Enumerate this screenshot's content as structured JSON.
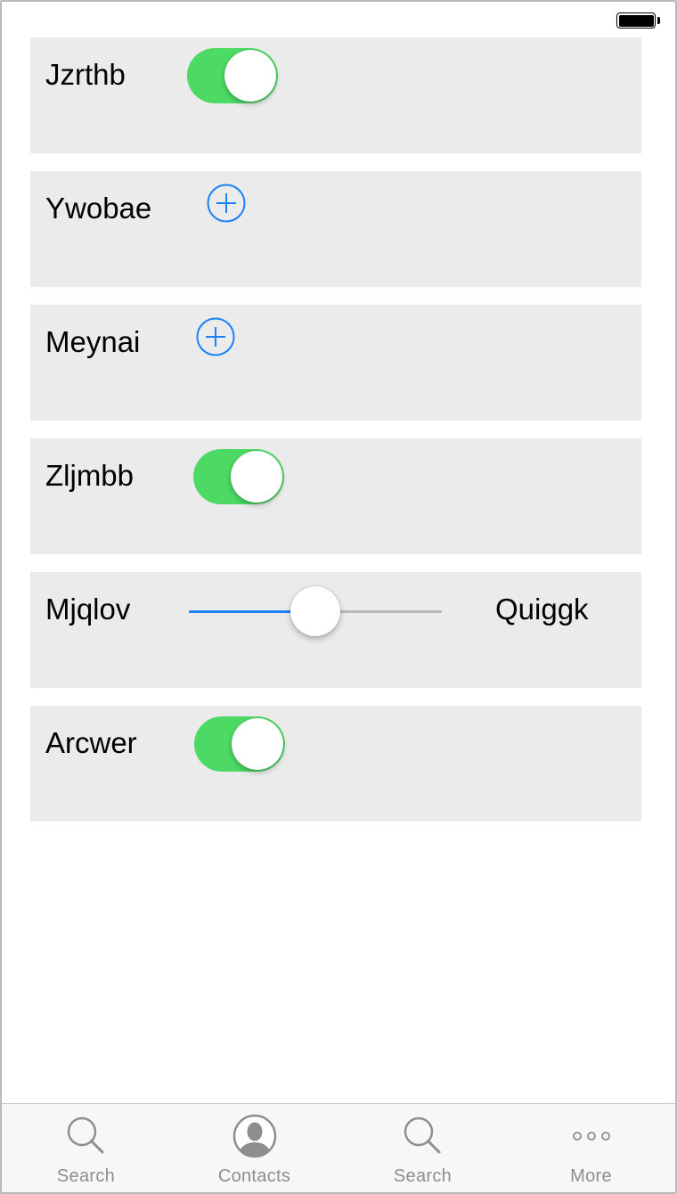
{
  "status_bar": {
    "battery_icon": "battery-full-icon"
  },
  "colors": {
    "accent": "#1a82fb",
    "toggle_on": "#4cd964",
    "row_background": "#ebebeb",
    "tab_inactive": "#8e8e8e"
  },
  "rows": [
    {
      "label": "Jzrthb",
      "control": "toggle",
      "checked": true
    },
    {
      "label": "Ywobae",
      "control": "add-button",
      "icon": "plus-circle-icon"
    },
    {
      "label": "Meynai",
      "control": "add-button",
      "icon": "plus-circle-icon"
    },
    {
      "label": "Zljmbb",
      "control": "toggle",
      "checked": true
    },
    {
      "label": "Mjqlov",
      "control": "slider",
      "value": 0.5,
      "max_label": "Quiggk"
    },
    {
      "label": "Arcwer",
      "control": "toggle",
      "checked": true
    }
  ],
  "tab_bar": {
    "tabs": [
      {
        "label": "Search",
        "icon": "search-icon"
      },
      {
        "label": "Contacts",
        "icon": "contact-icon"
      },
      {
        "label": "Search",
        "icon": "search-icon"
      },
      {
        "label": "More",
        "icon": "more-icon"
      }
    ]
  }
}
